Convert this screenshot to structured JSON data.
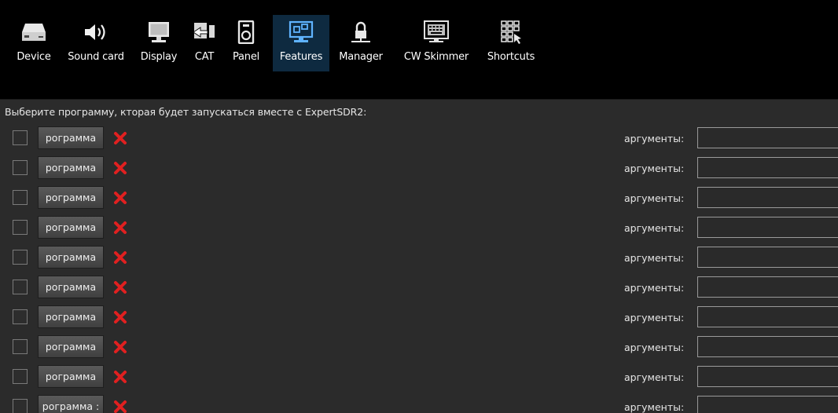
{
  "toolbar": {
    "tabs": [
      {
        "label": "Device",
        "icon": "device-icon"
      },
      {
        "label": "Sound card",
        "icon": "speaker-icon"
      },
      {
        "label": "Display",
        "icon": "monitor-icon"
      },
      {
        "label": "CAT",
        "icon": "cat-port-icon"
      },
      {
        "label": "Panel",
        "icon": "panel-icon"
      },
      {
        "label": "Features",
        "icon": "features-icon",
        "active": true
      },
      {
        "label": "Manager",
        "icon": "manager-icon"
      },
      {
        "label": "CW Skimmer",
        "icon": "keyboard-icon"
      },
      {
        "label": "Shortcuts",
        "icon": "shortcuts-icon"
      }
    ]
  },
  "main": {
    "intro": "Выберите программу, кторая будет запускаться вместе с ExpertSDR2:",
    "rows": [
      {
        "button": "рограмма",
        "args_label": "аргументы:",
        "args_value": "",
        "checked": false
      },
      {
        "button": "рограмма",
        "args_label": "аргументы:",
        "args_value": "",
        "checked": false
      },
      {
        "button": "рограмма",
        "args_label": "аргументы:",
        "args_value": "",
        "checked": false
      },
      {
        "button": "рограмма",
        "args_label": "аргументы:",
        "args_value": "",
        "checked": false
      },
      {
        "button": "рограмма",
        "args_label": "аргументы:",
        "args_value": "",
        "checked": false
      },
      {
        "button": "рограмма",
        "args_label": "аргументы:",
        "args_value": "",
        "checked": false
      },
      {
        "button": "рограмма",
        "args_label": "аргументы:",
        "args_value": "",
        "checked": false
      },
      {
        "button": "рограмма",
        "args_label": "аргументы:",
        "args_value": "",
        "checked": false
      },
      {
        "button": "рограмма",
        "args_label": "аргументы:",
        "args_value": "",
        "checked": false
      },
      {
        "button": "рограмма :",
        "args_label": "аргументы:",
        "args_value": "",
        "checked": false
      }
    ]
  },
  "colors": {
    "toolbar_bg": "#000000",
    "active_tab": "#0e2a40",
    "panel_bg": "#2b2b2b",
    "delete_red": "#e02020"
  }
}
